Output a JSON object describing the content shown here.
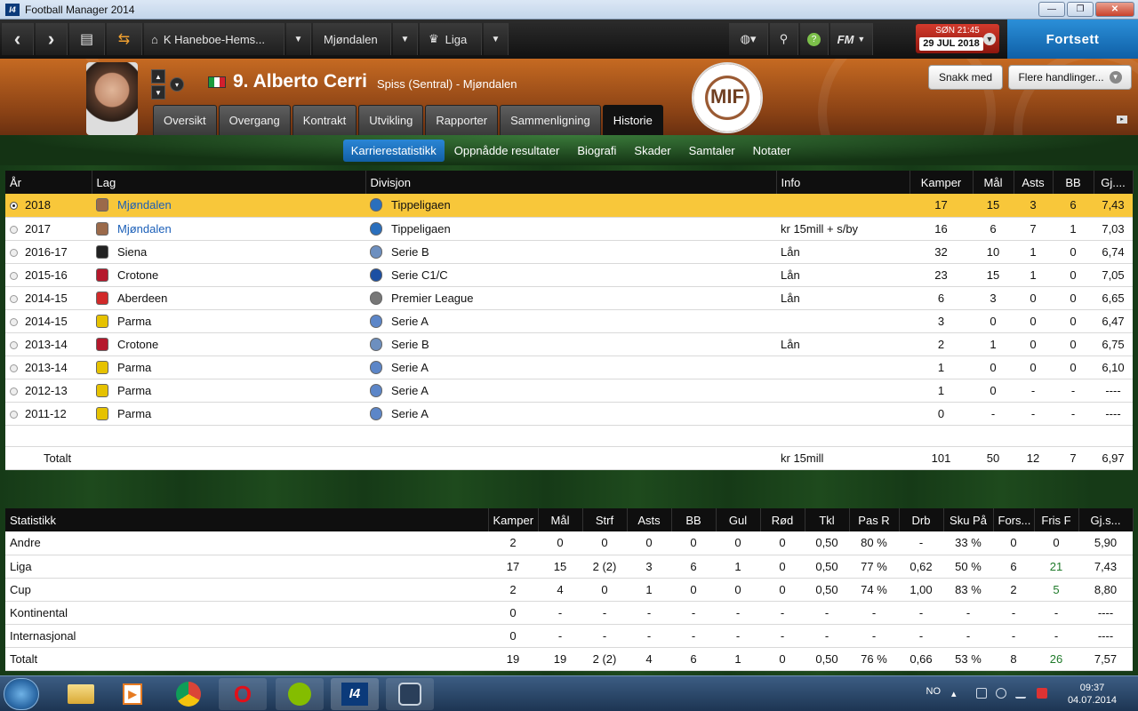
{
  "window": {
    "title": "Football Manager 2014",
    "minimize": "—",
    "maximize": "❐",
    "close": "✕"
  },
  "topbar": {
    "back": "‹",
    "forward": "›",
    "manager": "K Haneboe-Hems...",
    "team": "Mjøndalen",
    "competition": "Liga",
    "fm": "FM",
    "date_time": "SØN 21:45",
    "date": "29 JUL 2018",
    "continue": "Fortsett"
  },
  "player": {
    "name": "9. Alberto Cerri",
    "subtitle": "Spiss (Sentral) - Mjøndalen",
    "nationality_colors": [
      "#1a9b3c",
      "#ffffff",
      "#d2202e"
    ],
    "club_crest_letters": "MIF"
  },
  "actions": {
    "talk": "Snakk med",
    "more": "Flere handlinger..."
  },
  "tabs": [
    {
      "label": "Oversikt"
    },
    {
      "label": "Overgang"
    },
    {
      "label": "Kontrakt"
    },
    {
      "label": "Utvikling"
    },
    {
      "label": "Rapporter"
    },
    {
      "label": "Sammenligning"
    },
    {
      "label": "Historie"
    }
  ],
  "subtabs": [
    {
      "label": "Karrierestatistikk"
    },
    {
      "label": "Oppnådde resultater"
    },
    {
      "label": "Biografi"
    },
    {
      "label": "Skader"
    },
    {
      "label": "Samtaler"
    },
    {
      "label": "Notater"
    }
  ],
  "career": {
    "headers": [
      "År",
      "Lag",
      "Divisjon",
      "Info",
      "Kamper",
      "Mål",
      "Asts",
      "BB",
      "Gj...."
    ],
    "rows": [
      {
        "year": "2018",
        "club": "Mjøndalen",
        "division": "Tippeligaen",
        "info": "",
        "apps": "17",
        "goals": "15",
        "asts": "3",
        "bb": "6",
        "avg": "7,43",
        "club_color": "#9b6a4a",
        "div_color": "#2a6fbd"
      },
      {
        "year": "2017",
        "club": "Mjøndalen",
        "division": "Tippeligaen",
        "info": "kr 15mill + s/by",
        "apps": "16",
        "goals": "6",
        "asts": "7",
        "bb": "1",
        "avg": "7,03",
        "club_color": "#9b6a4a",
        "div_color": "#2a6fbd"
      },
      {
        "year": "2016-17",
        "club": "Siena",
        "division": "Serie B",
        "info": "Lån",
        "apps": "32",
        "goals": "10",
        "asts": "1",
        "bb": "0",
        "avg": "6,74",
        "club_color": "#222222",
        "div_color": "#6d8fbf"
      },
      {
        "year": "2015-16",
        "club": "Crotone",
        "division": "Serie C1/C",
        "info": "Lån",
        "apps": "23",
        "goals": "15",
        "asts": "1",
        "bb": "0",
        "avg": "7,05",
        "club_color": "#b5182c",
        "div_color": "#1b4fa3"
      },
      {
        "year": "2014-15",
        "club": "Aberdeen",
        "division": "Premier League",
        "info": "Lån",
        "apps": "6",
        "goals": "3",
        "asts": "0",
        "bb": "0",
        "avg": "6,65",
        "club_color": "#d12a2a",
        "div_color": "#777777"
      },
      {
        "year": "2014-15",
        "club": "Parma",
        "division": "Serie A",
        "info": "",
        "apps": "3",
        "goals": "0",
        "asts": "0",
        "bb": "0",
        "avg": "6,47",
        "club_color": "#e6c200",
        "div_color": "#5c86c8"
      },
      {
        "year": "2013-14",
        "club": "Crotone",
        "division": "Serie B",
        "info": "Lån",
        "apps": "2",
        "goals": "1",
        "asts": "0",
        "bb": "0",
        "avg": "6,75",
        "club_color": "#b5182c",
        "div_color": "#6d8fbf"
      },
      {
        "year": "2013-14",
        "club": "Parma",
        "division": "Serie A",
        "info": "",
        "apps": "1",
        "goals": "0",
        "asts": "0",
        "bb": "0",
        "avg": "6,10",
        "club_color": "#e6c200",
        "div_color": "#5c86c8"
      },
      {
        "year": "2012-13",
        "club": "Parma",
        "division": "Serie A",
        "info": "",
        "apps": "1",
        "goals": "0",
        "asts": "-",
        "bb": "-",
        "avg": "----",
        "club_color": "#e6c200",
        "div_color": "#5c86c8"
      },
      {
        "year": "2011-12",
        "club": "Parma",
        "division": "Serie A",
        "info": "",
        "apps": "0",
        "goals": "-",
        "asts": "-",
        "bb": "-",
        "avg": "----",
        "club_color": "#e6c200",
        "div_color": "#5c86c8"
      }
    ],
    "total": {
      "label": "Totalt",
      "info": "kr 15mill",
      "apps": "101",
      "goals": "50",
      "asts": "12",
      "bb": "7",
      "avg": "6,97"
    }
  },
  "stats": {
    "headers": [
      "Statistikk",
      "Kamper",
      "Mål",
      "Strf",
      "Asts",
      "BB",
      "Gul",
      "Rød",
      "Tkl",
      "Pas R",
      "Drb",
      "Sku På",
      "Fors...",
      "Fris F",
      "Gj.s..."
    ],
    "rows": [
      [
        "Andre",
        "2",
        "0",
        "0",
        "0",
        "0",
        "0",
        "0",
        "0,50",
        "80 %",
        "-",
        "33 %",
        "0",
        "0",
        "5,90"
      ],
      [
        "Liga",
        "17",
        "15",
        "2 (2)",
        "3",
        "6",
        "1",
        "0",
        "0,50",
        "77 %",
        "0,62",
        "50 %",
        "6",
        "21",
        "7,43"
      ],
      [
        "Cup",
        "2",
        "4",
        "0",
        "1",
        "0",
        "0",
        "0",
        "0,50",
        "74 %",
        "1,00",
        "83 %",
        "2",
        "5",
        "8,80"
      ],
      [
        "Kontinental",
        "0",
        "-",
        "-",
        "-",
        "-",
        "-",
        "-",
        "-",
        "-",
        "-",
        "-",
        "-",
        "-",
        "----"
      ],
      [
        "Internasjonal",
        "0",
        "-",
        "-",
        "-",
        "-",
        "-",
        "-",
        "-",
        "-",
        "-",
        "-",
        "-",
        "-",
        "----"
      ],
      [
        "Totalt",
        "19",
        "19",
        "2 (2)",
        "4",
        "6",
        "1",
        "0",
        "0,50",
        "76 %",
        "0,66",
        "53 %",
        "8",
        "26",
        "7,57"
      ]
    ]
  },
  "taskbar": {
    "apps": [
      {
        "name": "explorer"
      },
      {
        "name": "media-player"
      },
      {
        "name": "chrome"
      },
      {
        "name": "opera",
        "label": "O"
      },
      {
        "name": "spotify"
      },
      {
        "name": "fm14",
        "label": "I4"
      },
      {
        "name": "steam"
      }
    ],
    "lang": "NO",
    "time": "09:37",
    "date": "04.07.2014"
  }
}
